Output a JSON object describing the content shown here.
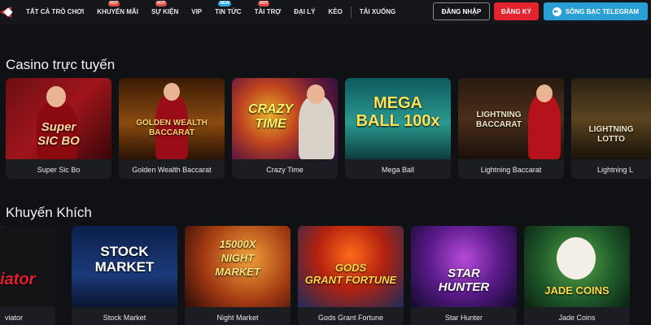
{
  "nav": {
    "items": [
      {
        "label": "TẤT CẢ TRÒ CHƠI",
        "badge": ""
      },
      {
        "label": "KHUYẾN MÃI",
        "badge": "HOT"
      },
      {
        "label": "SỰ KIỆN",
        "badge": "HOT"
      },
      {
        "label": "VIP",
        "badge": ""
      },
      {
        "label": "TIN TỨC",
        "badge": "NEW"
      },
      {
        "label": "TÀI TRỢ",
        "badge": "HOT"
      },
      {
        "label": "ĐẠI LÝ",
        "badge": ""
      },
      {
        "label": "KÈO",
        "badge": ""
      },
      {
        "label": "TẢI XUỐNG",
        "badge": ""
      }
    ],
    "login_label": "ĐĂNG NHẬP",
    "register_label": "ĐĂNG KÝ",
    "telegram_label": "SÒNG BẠC TELEGRAM"
  },
  "casino": {
    "title": "Casino trực tuyến",
    "games": [
      {
        "label": "Super Sic Bo",
        "art": "Super\nSIC BO"
      },
      {
        "label": "Golden Wealth Baccarat",
        "art": "GOLDEN WEALTH\nBACCARAT"
      },
      {
        "label": "Crazy Time",
        "art": "CRAZY\nTIME"
      },
      {
        "label": "Mega Ball",
        "art": "MEGA\nBALL 100x"
      },
      {
        "label": "Lightning Baccarat",
        "art": "LIGHTNING\nBACCARAT"
      },
      {
        "label": "Lightning L",
        "art": "LIGHTNING\nLOTTO"
      }
    ]
  },
  "promo": {
    "title": "Khuyến Khích",
    "games": [
      {
        "label": "viator",
        "art": "iator"
      },
      {
        "label": "Stock Market",
        "art": "STOCK\nMARKET"
      },
      {
        "label": "Night Market",
        "art": "15000X\nNIGHT\nMARKET"
      },
      {
        "label": "Gods Grant Fortune",
        "art": "GODS\nGRANT FORTUNE"
      },
      {
        "label": "Star Hunter",
        "art": "STAR\nHUNTER"
      },
      {
        "label": "Jade Coins",
        "art": "JADE COINS"
      }
    ]
  }
}
